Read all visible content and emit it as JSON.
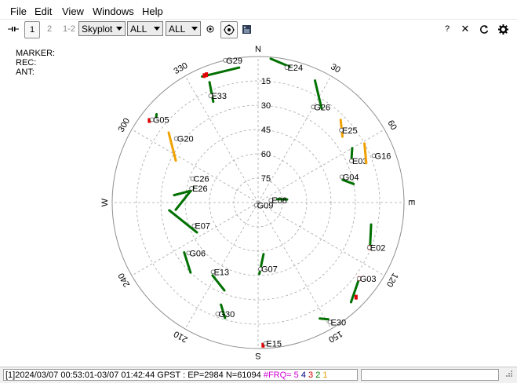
{
  "menu": [
    "File",
    "Edit",
    "View",
    "Windows",
    "Help"
  ],
  "toolbar": {
    "mode1": "1",
    "mode2": "2",
    "mode12": "1-2",
    "plot_type": "Skyplot",
    "sys_filter": "ALL",
    "sat_filter": "ALL",
    "help": "?",
    "close": "✕"
  },
  "info": {
    "marker": "MARKER:",
    "rec": "REC:",
    "ant": "ANT:"
  },
  "skyplot": {
    "compass": {
      "N": "N",
      "E": "E",
      "S": "S",
      "W": "W"
    },
    "az_labels": [
      {
        "az": 30,
        "text": "30"
      },
      {
        "az": 60,
        "text": "60"
      },
      {
        "az": 120,
        "text": "120"
      },
      {
        "az": 150,
        "text": "150"
      },
      {
        "az": 210,
        "text": "210"
      },
      {
        "az": 240,
        "text": "240"
      },
      {
        "az": 300,
        "text": "300"
      },
      {
        "az": 330,
        "text": "330"
      }
    ],
    "el_labels": [
      "15",
      "30",
      "45",
      "60",
      "75"
    ],
    "colors": {
      "track": "#007000",
      "track_alt": "#f0a000",
      "slip": "#e00000",
      "grid": "#a8a8a8"
    },
    "satellites": [
      {
        "id": "G29",
        "az": 347,
        "el": 0,
        "track": [
          [
            336,
            5
          ],
          [
            352,
            6
          ]
        ],
        "color": "track",
        "slip": [
          [
            337,
            5
          ],
          [
            338,
            5
          ]
        ]
      },
      {
        "id": "E24",
        "az": 12,
        "el": 5,
        "track": [
          [
            5,
            1
          ],
          [
            13,
            4
          ]
        ],
        "color": "track"
      },
      {
        "id": "E33",
        "az": 336,
        "el": 18,
        "track": [
          [
            338,
            10
          ],
          [
            336,
            22
          ]
        ],
        "color": "track"
      },
      {
        "id": "G26",
        "az": 30,
        "el": 22,
        "track": [
          [
            25,
            7
          ],
          [
            34,
            20
          ]
        ],
        "color": "track"
      },
      {
        "id": "G05",
        "az": 308,
        "el": 7,
        "track": [
          [
            311,
            7
          ],
          [
            310,
            8
          ]
        ],
        "color": "track",
        "slip": [
          [
            307,
            6
          ]
        ]
      },
      {
        "id": "G20",
        "az": 308,
        "el": 26,
        "track": [
          [
            308,
            20
          ],
          [
            297,
            33
          ]
        ],
        "color": "track_alt"
      },
      {
        "id": "E25",
        "az": 49,
        "el": 22,
        "track": [
          [
            45,
            18
          ],
          [
            52,
            24
          ]
        ],
        "color": "track_alt"
      },
      {
        "id": "E03",
        "az": 66,
        "el": 27,
        "track": [
          [
            60,
            23
          ],
          [
            66,
            27
          ]
        ],
        "color": "track"
      },
      {
        "id": "G16",
        "az": 68,
        "el": 13,
        "track": [
          [
            61,
            15
          ],
          [
            70,
            19
          ]
        ],
        "color": "track_alt"
      },
      {
        "id": "G04",
        "az": 73,
        "el": 36,
        "track": [
          [
            75,
            36
          ],
          [
            79,
            30
          ]
        ],
        "color": "track"
      },
      {
        "id": "E08",
        "az": 80,
        "el": 82,
        "track": [
          [
            80,
            78
          ],
          [
            84,
            72
          ]
        ],
        "color": "track"
      },
      {
        "id": "G09",
        "az": 215,
        "el": 88,
        "track": [
          [
            200,
            88
          ],
          [
            220,
            88
          ]
        ],
        "color": "track"
      },
      {
        "id": "C26",
        "az": 290,
        "el": 47,
        "track": [
          [
            275,
            38
          ],
          [
            280,
            48
          ]
        ],
        "color": "track"
      },
      {
        "id": "E26",
        "az": 282,
        "el": 48,
        "track": [
          [
            265,
            39
          ],
          [
            283,
            49
          ]
        ],
        "color": "track"
      },
      {
        "id": "E07",
        "az": 250,
        "el": 48,
        "track": [
          [
            244,
            48
          ],
          [
            265,
            35
          ]
        ],
        "color": "track"
      },
      {
        "id": "G06",
        "az": 234,
        "el": 37,
        "track": [
          [
            236,
            35
          ],
          [
            224,
            30
          ]
        ],
        "color": "track"
      },
      {
        "id": "E13",
        "az": 213,
        "el": 39,
        "track": [
          [
            212,
            37
          ],
          [
            201,
            32
          ]
        ],
        "color": "track"
      },
      {
        "id": "G07",
        "az": 178,
        "el": 49,
        "track": [
          [
            174,
            58
          ],
          [
            179,
            46
          ]
        ],
        "color": "track"
      },
      {
        "id": "G30",
        "az": 200,
        "el": 17,
        "track": [
          [
            200,
            23
          ],
          [
            196,
            16
          ]
        ],
        "color": "track"
      },
      {
        "id": "E15",
        "az": 177,
        "el": 3,
        "track": [
          [
            177,
            3
          ]
        ],
        "color": "track",
        "slip": [
          [
            178,
            2
          ]
        ]
      },
      {
        "id": "E30",
        "az": 149,
        "el": 4,
        "track": [
          [
            149,
            6
          ],
          [
            152,
            9
          ]
        ],
        "color": "track"
      },
      {
        "id": "G03",
        "az": 127,
        "el": 12,
        "track": [
          [
            127,
            12
          ],
          [
            137,
            6
          ]
        ],
        "color": "track",
        "slip": [
          [
            127,
            12
          ],
          [
            134,
            6
          ]
        ]
      },
      {
        "id": "E02",
        "az": 112,
        "el": 16,
        "track": [
          [
            101,
            19
          ],
          [
            111,
            16
          ]
        ],
        "color": "track",
        "slip": [
          [
            112,
            16
          ]
        ]
      }
    ]
  },
  "status": {
    "prefix": "[1]2024/03/07 00:53:01-03/07 01:42:44 GPST : EP=2984 N=61094 ",
    "frq_label": "#FRQ= 5",
    "c4": " 4",
    "c3": " 3",
    "c2": " 2",
    "c1": " 1"
  }
}
